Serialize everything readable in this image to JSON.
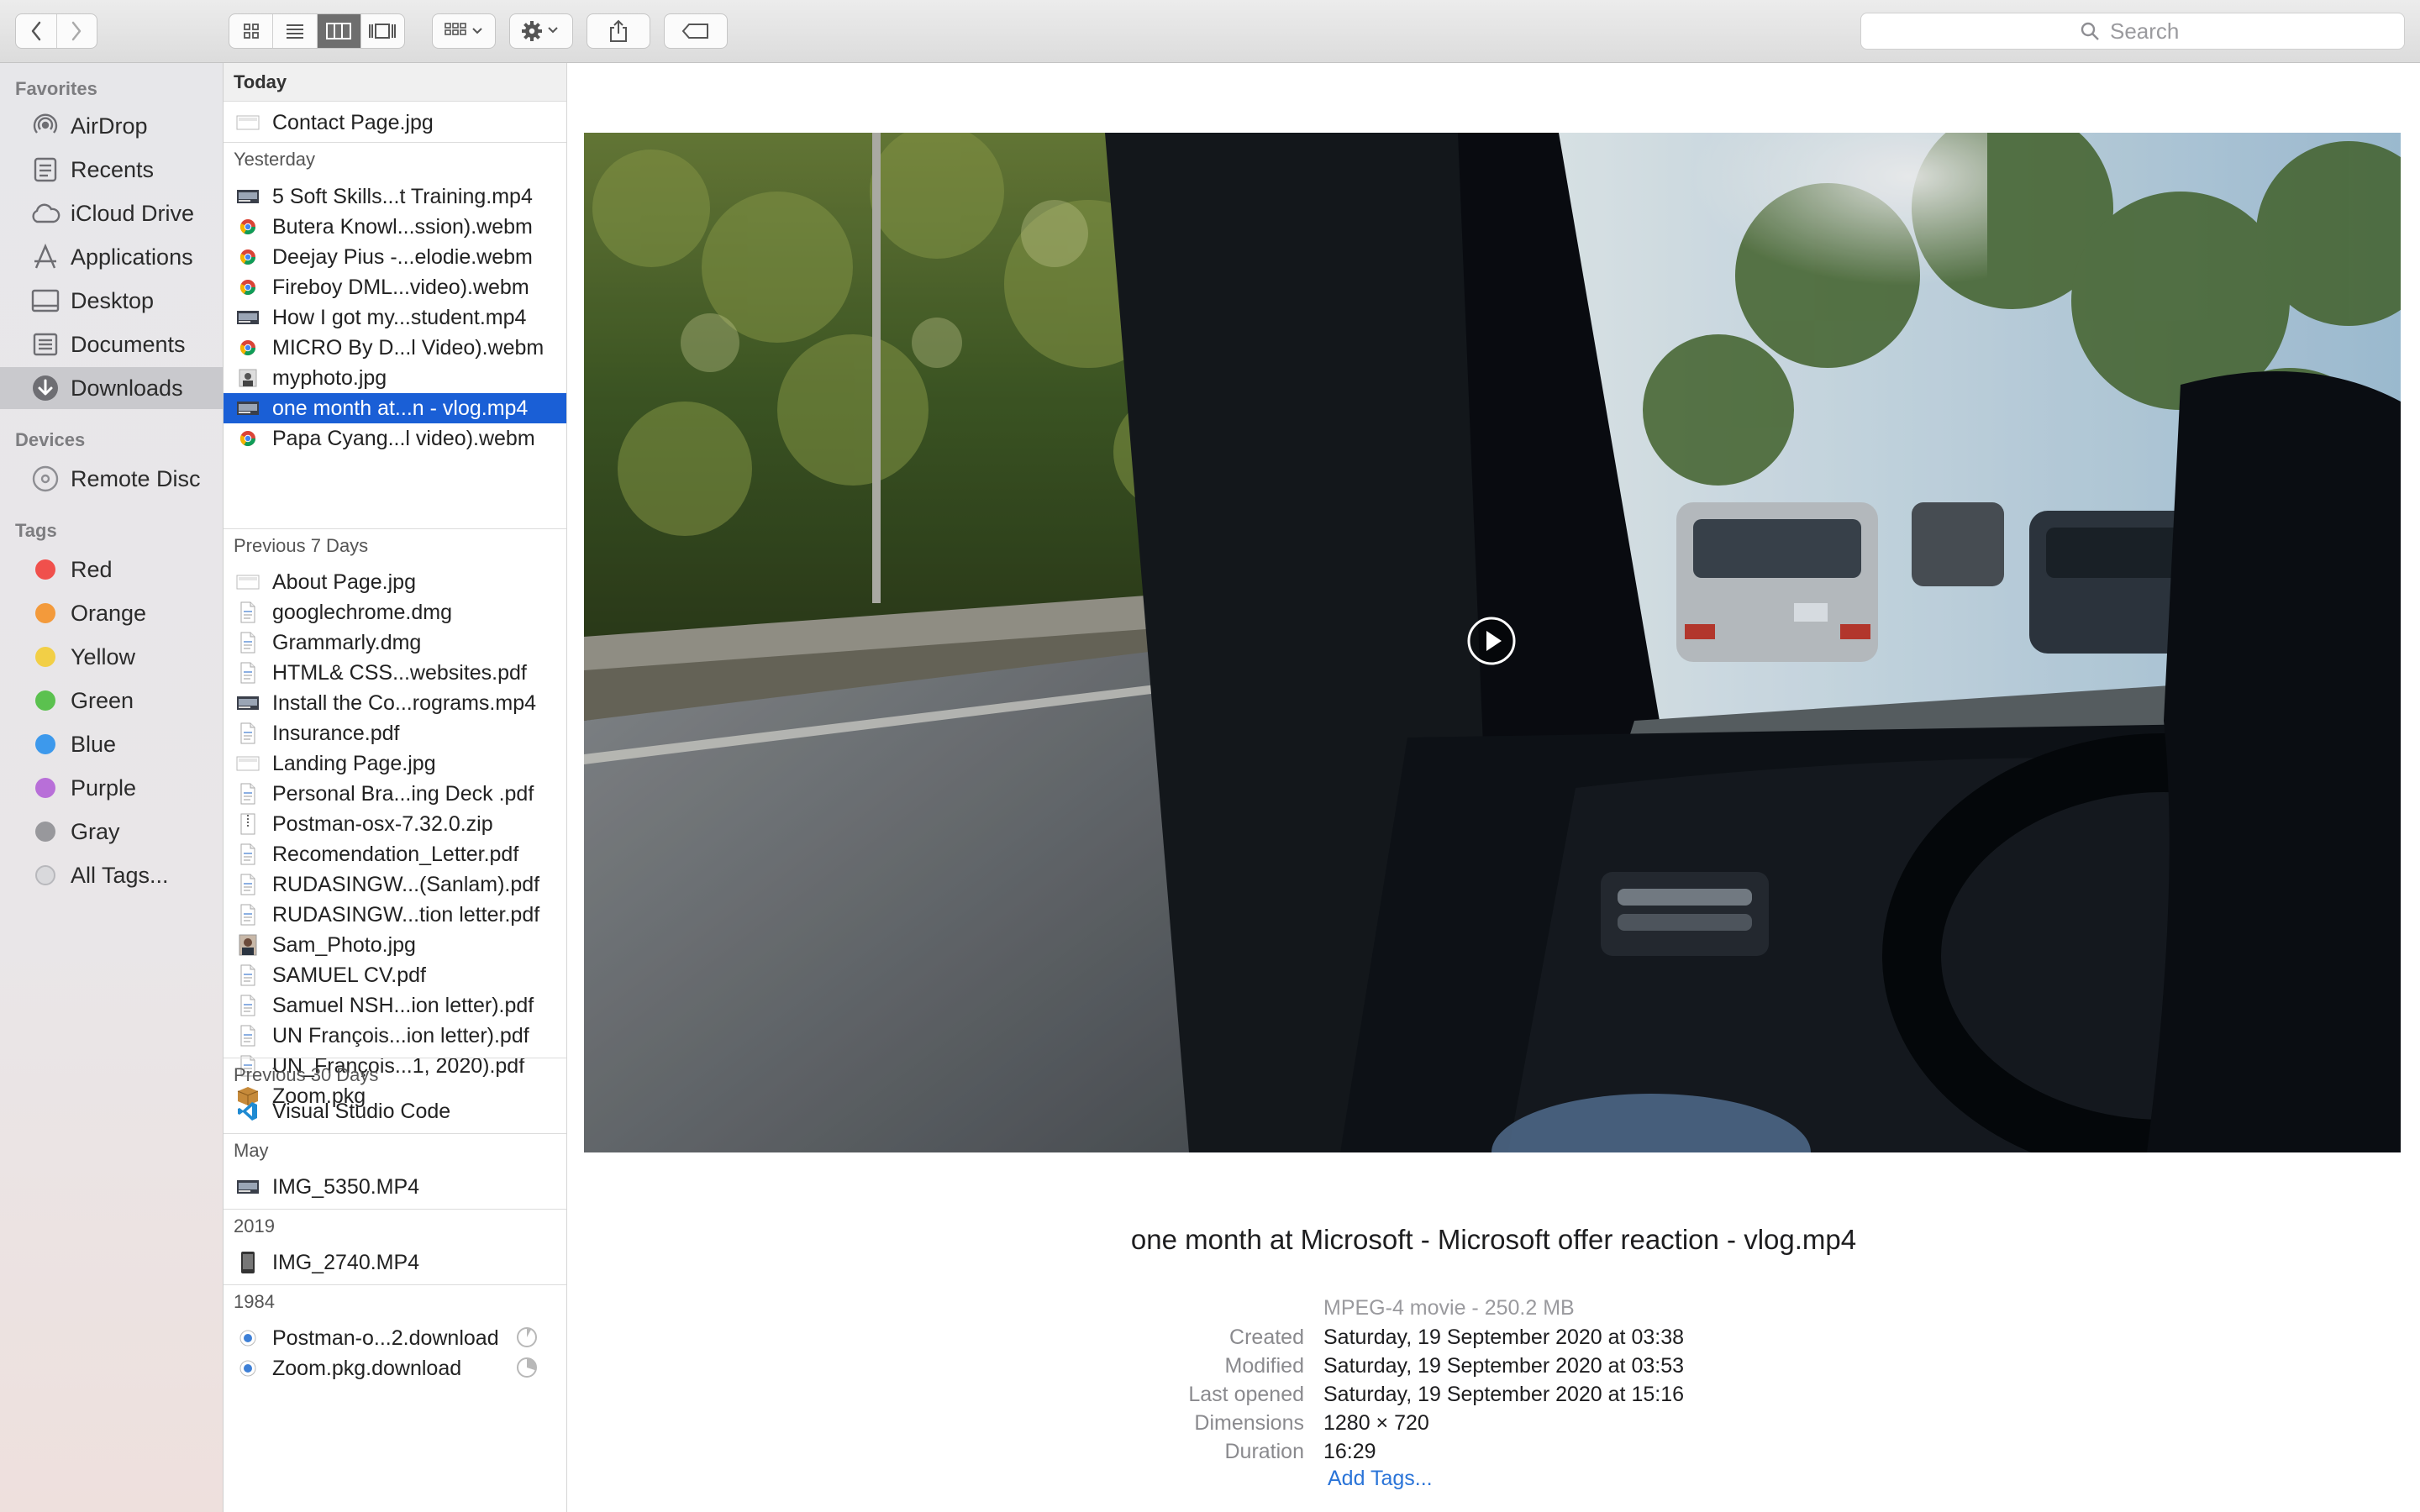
{
  "toolbar": {
    "search_placeholder": "Search",
    "icons": [
      "chevron-left-icon",
      "chevron-right-icon",
      "icon-view-icon",
      "list-view-icon",
      "column-view-icon",
      "gallery-view-icon",
      "group-icon",
      "gear-icon",
      "share-icon",
      "tag-icon",
      "search-icon"
    ]
  },
  "sidebar": {
    "favorites_header": "Favorites",
    "favorites": [
      {
        "label": "AirDrop",
        "icon": "airdrop-icon"
      },
      {
        "label": "Recents",
        "icon": "recents-icon"
      },
      {
        "label": "iCloud Drive",
        "icon": "cloud-icon"
      },
      {
        "label": "Applications",
        "icon": "applications-icon"
      },
      {
        "label": "Desktop",
        "icon": "desktop-icon"
      },
      {
        "label": "Documents",
        "icon": "documents-icon"
      },
      {
        "label": "Downloads",
        "icon": "downloads-icon",
        "selected": true
      }
    ],
    "devices_header": "Devices",
    "devices": [
      {
        "label": "Remote Disc",
        "icon": "disc-icon"
      }
    ],
    "tags_header": "Tags",
    "tags": [
      {
        "label": "Red",
        "color": "#f0504c"
      },
      {
        "label": "Orange",
        "color": "#f39a3b"
      },
      {
        "label": "Yellow",
        "color": "#f2cf46"
      },
      {
        "label": "Green",
        "color": "#5bc14f"
      },
      {
        "label": "Blue",
        "color": "#3d99ec"
      },
      {
        "label": "Purple",
        "color": "#b86fd8"
      },
      {
        "label": "Gray",
        "color": "#98989c"
      },
      {
        "label": "All Tags...",
        "color": "#d9d9dc"
      }
    ]
  },
  "groups": {
    "today": "Today",
    "yesterday": "Yesterday",
    "prev7": "Previous 7 Days",
    "prev30": "Previous 30 Days",
    "may": "May",
    "y2019": "2019",
    "y1984": "1984"
  },
  "files": {
    "today": [
      {
        "name": "Contact Page.jpg",
        "icon": "image-icon"
      }
    ],
    "yesterday": [
      {
        "name": "5 Soft Skills...t Training.mp4",
        "icon": "video-thumb-icon"
      },
      {
        "name": "Butera Knowl...ssion).webm",
        "icon": "chrome-icon"
      },
      {
        "name": "Deejay Pius -...elodie.webm",
        "icon": "chrome-icon"
      },
      {
        "name": "Fireboy DML...video).webm",
        "icon": "chrome-icon"
      },
      {
        "name": "How I got my...student.mp4",
        "icon": "video-thumb-icon"
      },
      {
        "name": "MICRO By D...l Video).webm",
        "icon": "chrome-icon"
      },
      {
        "name": "myphoto.jpg",
        "icon": "photo-icon"
      },
      {
        "name": "one month at...n - vlog.mp4",
        "icon": "video-thumb-icon",
        "selected": true
      },
      {
        "name": "Papa Cyang...l video).webm",
        "icon": "chrome-icon"
      }
    ],
    "prev7": [
      {
        "name": "About Page.jpg",
        "icon": "image-icon"
      },
      {
        "name": "googlechrome.dmg",
        "icon": "document-icon"
      },
      {
        "name": "Grammarly.dmg",
        "icon": "document-icon"
      },
      {
        "name": "HTML& CSS...websites.pdf",
        "icon": "document-icon"
      },
      {
        "name": "Install the Co...rograms.mp4",
        "icon": "video-thumb-icon"
      },
      {
        "name": "Insurance.pdf",
        "icon": "document-icon"
      },
      {
        "name": "Landing Page.jpg",
        "icon": "image-icon"
      },
      {
        "name": "Personal Bra...ing  Deck .pdf",
        "icon": "document-icon"
      },
      {
        "name": "Postman-osx-7.32.0.zip",
        "icon": "zip-icon"
      },
      {
        "name": "Recomendation_Letter.pdf",
        "icon": "document-icon"
      },
      {
        "name": "RUDASINGW...(Sanlam).pdf",
        "icon": "document-icon"
      },
      {
        "name": "RUDASINGW...tion letter.pdf",
        "icon": "document-icon"
      },
      {
        "name": "Sam_Photo.jpg",
        "icon": "portrait-icon"
      },
      {
        "name": "SAMUEL CV.pdf",
        "icon": "document-icon"
      },
      {
        "name": "Samuel NSH...ion letter).pdf",
        "icon": "document-icon"
      },
      {
        "name": "UN François...ion letter).pdf",
        "icon": "document-icon"
      },
      {
        "name": "UN_François...1, 2020).pdf",
        "icon": "document-icon"
      },
      {
        "name": "Zoom.pkg",
        "icon": "package-icon"
      }
    ],
    "prev30": [
      {
        "name": "Visual Studio Code",
        "icon": "vscode-icon"
      }
    ],
    "may": [
      {
        "name": "IMG_5350.MP4",
        "icon": "video-thumb-icon"
      }
    ],
    "y2019": [
      {
        "name": "IMG_2740.MP4",
        "icon": "phone-video-icon"
      }
    ],
    "y1984": [
      {
        "name": "Postman-o...2.download",
        "icon": "download-file-icon",
        "progress": 0.08
      },
      {
        "name": "Zoom.pkg.download",
        "icon": "download-file-icon",
        "progress": 0.3
      }
    ]
  },
  "preview": {
    "filename": "one month at Microsoft - Microsoft offer reaction - vlog.mp4",
    "type": "MPEG-4 movie - 250.2 MB",
    "meta": [
      {
        "key": "Created",
        "value": "Saturday, 19 September 2020 at 03:38"
      },
      {
        "key": "Modified",
        "value": "Saturday, 19 September 2020 at 03:53"
      },
      {
        "key": "Last opened",
        "value": "Saturday, 19 September 2020 at 15:16"
      },
      {
        "key": "Dimensions",
        "value": "1280 × 720"
      },
      {
        "key": "Duration",
        "value": "16:29"
      }
    ],
    "add_tags": "Add Tags..."
  }
}
